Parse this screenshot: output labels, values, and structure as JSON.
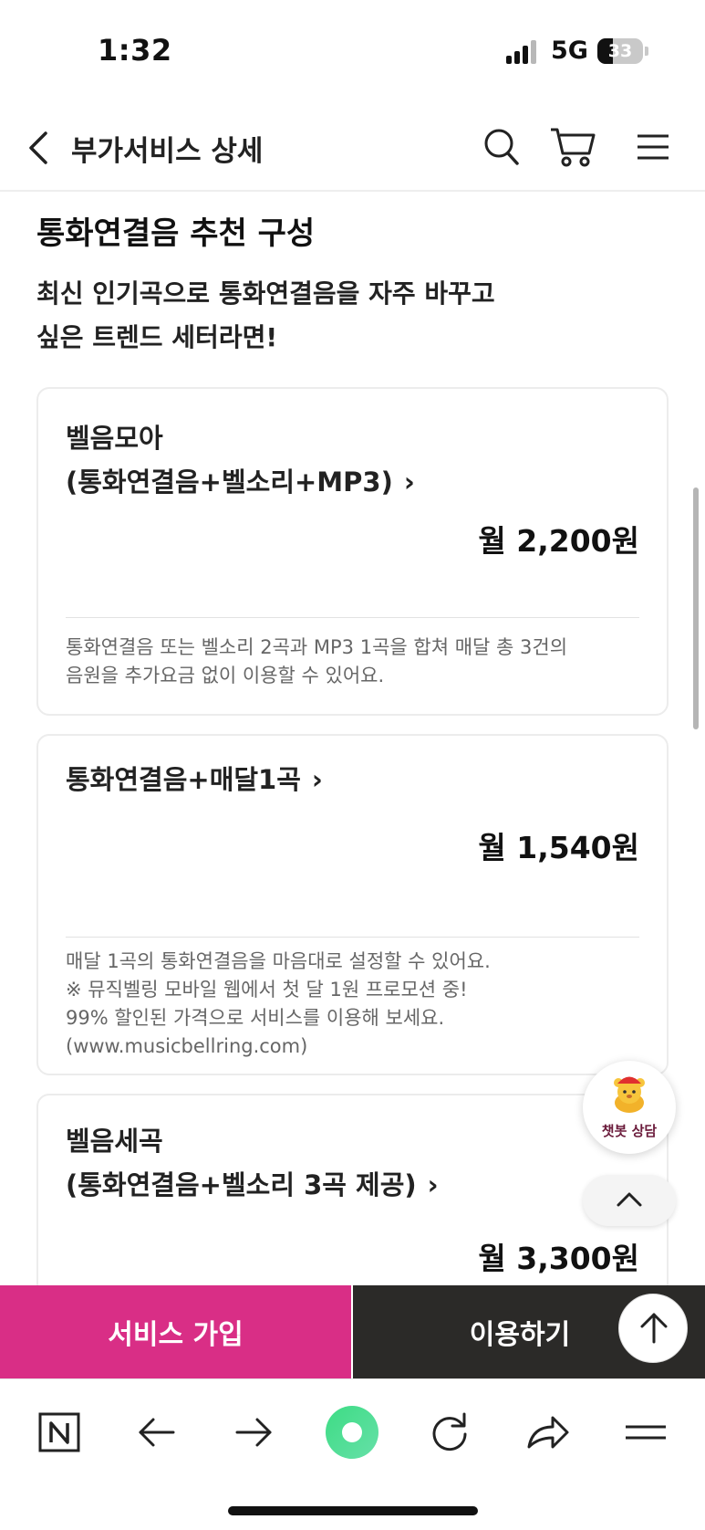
{
  "status_bar": {
    "time": "1:32",
    "network": "5G",
    "battery": "33",
    "battery_fraction": 0.33
  },
  "header": {
    "title": "부가서비스 상세"
  },
  "section": {
    "title": "통화연결음 추천 구성",
    "description_line1": "최신 인기곡으로 통화연결음을 자주 바꾸고",
    "description_line2": "싶은 트렌드 세터라면!"
  },
  "cards": [
    {
      "name_line1": "벨음모아",
      "name_line2": "(통화연결음+벨소리+MP3)",
      "price": "월 2,200원",
      "desc": [
        "통화연결음 또는 벨소리 2곡과 MP3 1곡을 합쳐 매달 총 3건의",
        "음원을 추가요금 없이 이용할 수 있어요."
      ]
    },
    {
      "name_line1": "통화연결음+매달1곡",
      "price": "월 1,540원",
      "desc": [
        "매달 1곡의 통화연결음을 마음대로 설정할 수 있어요.",
        "※ 뮤직벨링 모바일 웹에서 첫 달 1원 프로모션 중!",
        "99% 할인된 가격으로 서비스를 이용해 보세요.",
        "(www.musicbellring.com)"
      ]
    },
    {
      "name_line1": "벨음세곡",
      "name_line2": "(통화연결음+벨소리 3곡 제공)",
      "price": "월 3,300원"
    }
  ],
  "chatbot": {
    "label": "챗봇 상담"
  },
  "cta": {
    "join": "서비스 가입",
    "use": "이용하기"
  },
  "icons": {
    "chevron": "›",
    "colors": {
      "accent": "#d92e86",
      "dark": "#2b2a28",
      "green": "#3ddc84"
    }
  }
}
